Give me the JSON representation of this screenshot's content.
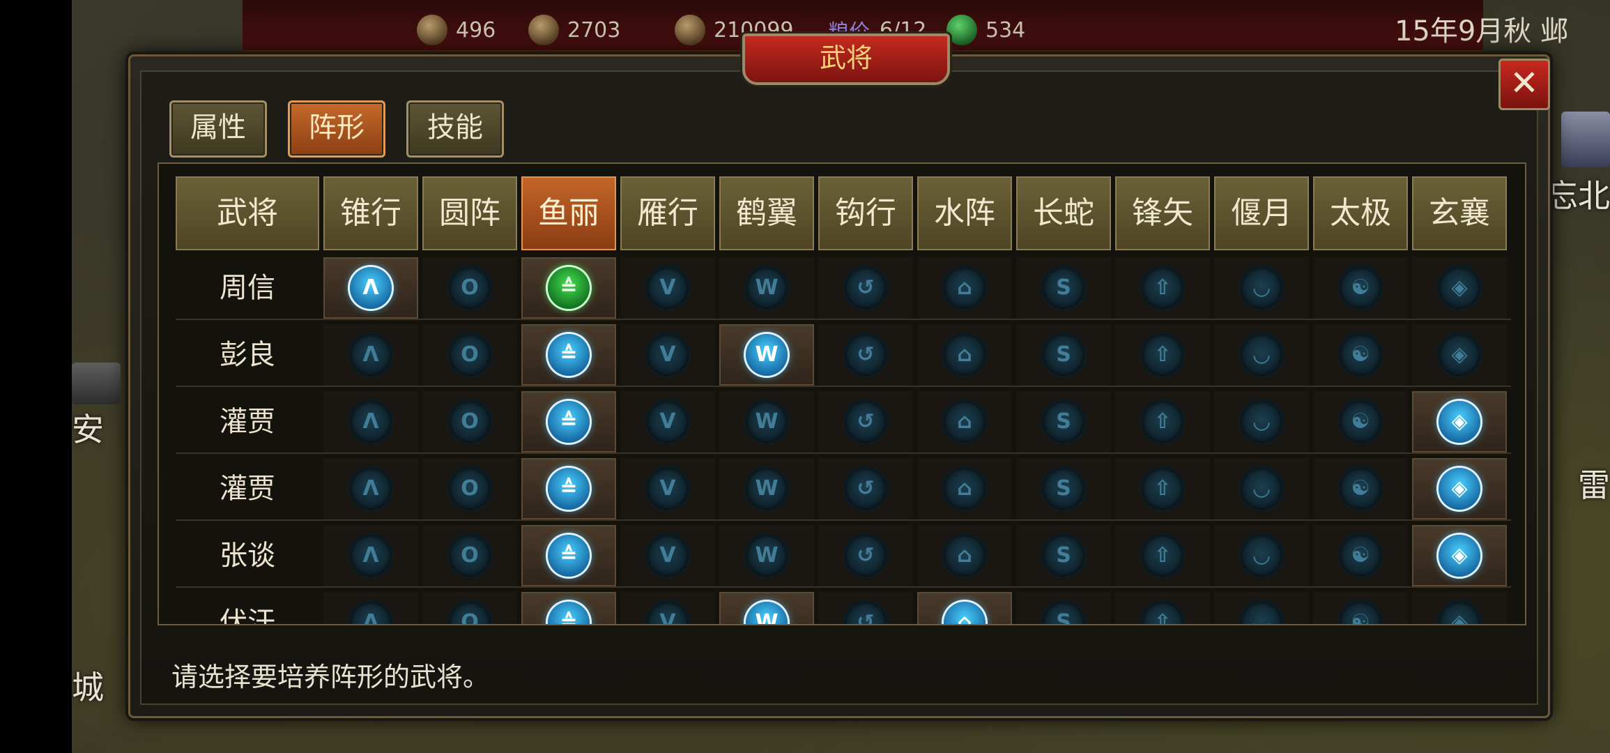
{
  "resources": [
    {
      "name": "coin-1",
      "value": "496"
    },
    {
      "name": "coin-2",
      "value": "2703"
    },
    {
      "name": "coin-3",
      "value": "210099"
    },
    {
      "name": "grain-price",
      "label": "粮价",
      "value": "6/12"
    },
    {
      "name": "grain",
      "value": "534"
    }
  ],
  "date": "15年9月秋 邺",
  "map_labels": {
    "left_top": "安",
    "left_bottom": "城",
    "right_top": "忘北",
    "right_mid": "雷"
  },
  "dialog": {
    "title": "武将",
    "close_label": "✕"
  },
  "tabs": [
    {
      "label": "属性",
      "active": false
    },
    {
      "label": "阵形",
      "active": true
    },
    {
      "label": "技能",
      "active": false
    }
  ],
  "columns": [
    "武将",
    "锥行",
    "圆阵",
    "鱼丽",
    "雁行",
    "鹤翼",
    "钩行",
    "水阵",
    "长蛇",
    "锋矢",
    "偃月",
    "太极",
    "玄襄"
  ],
  "selected_column": "鱼丽",
  "formation_icons": [
    {
      "name": "cone-formation-icon",
      "glyph": "Λ"
    },
    {
      "name": "circle-formation-icon",
      "glyph": "O"
    },
    {
      "name": "fish-formation-icon",
      "glyph": "≙"
    },
    {
      "name": "goose-formation-icon",
      "glyph": "V"
    },
    {
      "name": "crane-formation-icon",
      "glyph": "W"
    },
    {
      "name": "hook-formation-icon",
      "glyph": "↺"
    },
    {
      "name": "water-formation-icon",
      "glyph": "⌂"
    },
    {
      "name": "snake-formation-icon",
      "glyph": "S"
    },
    {
      "name": "arrow-formation-icon",
      "glyph": "⇧"
    },
    {
      "name": "crescent-formation-icon",
      "glyph": "◡"
    },
    {
      "name": "taiji-formation-icon",
      "glyph": "☯"
    },
    {
      "name": "xuanxiang-formation-icon",
      "glyph": "◈"
    }
  ],
  "rows": [
    {
      "name": "周信",
      "owned": [
        0,
        2
      ],
      "lit": [
        0
      ],
      "green": [
        2
      ]
    },
    {
      "name": "彭良",
      "owned": [
        2,
        4
      ],
      "lit": [
        2,
        4
      ],
      "green": []
    },
    {
      "name": "灌贾",
      "owned": [
        2,
        11
      ],
      "lit": [
        2,
        11
      ],
      "green": []
    },
    {
      "name": "灌贾",
      "owned": [
        2,
        11
      ],
      "lit": [
        2,
        11
      ],
      "green": []
    },
    {
      "name": "张谈",
      "owned": [
        2,
        11
      ],
      "lit": [
        2,
        11
      ],
      "green": []
    },
    {
      "name": "伏汗",
      "owned": [
        2,
        4,
        6
      ],
      "lit": [
        2,
        4,
        6
      ],
      "green": []
    }
  ],
  "instruction": "请选择要培养阵形的武将。",
  "colors": {
    "accent": "#c66a2a",
    "title_red": "#c42a1e",
    "icon_blue": "#4bd0ff",
    "icon_green": "#44e04e"
  }
}
